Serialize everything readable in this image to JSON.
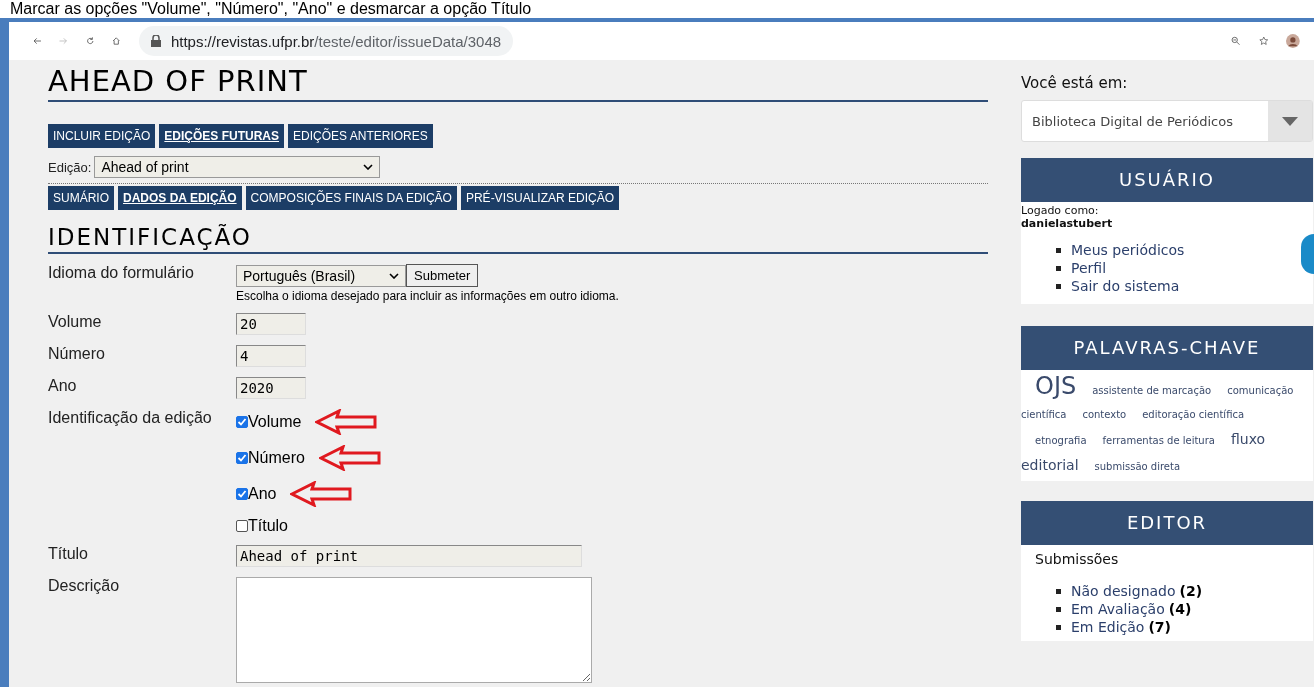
{
  "caption": "Marcar as opções \"Volume\", \"Número\", \"Ano\" e desmarcar a opção Título",
  "browser": {
    "url_host": "https://revistas.ufpr.br",
    "url_path": "/teste/editor/issueData/3048"
  },
  "page_title": "AHEAD OF PRINT",
  "issue_tabs": [
    {
      "label": "INCLUIR EDIÇÃO",
      "selected": false
    },
    {
      "label": "EDIÇÕES FUTURAS",
      "selected": true
    },
    {
      "label": "EDIÇÕES ANTERIORES",
      "selected": false
    }
  ],
  "issue_select": {
    "label": "Edição:",
    "value": "Ahead of print"
  },
  "sub_tabs": [
    {
      "label": "SUMÁRIO",
      "selected": false
    },
    {
      "label": "DADOS DA EDIÇÃO",
      "selected": true
    },
    {
      "label": "COMPOSIÇÕES FINAIS DA EDIÇÃO",
      "selected": false
    },
    {
      "label": "PRÉ-VISUALIZAR EDIÇÃO",
      "selected": false
    }
  ],
  "section_title": "IDENTIFICAÇÃO",
  "form": {
    "language": {
      "label": "Idioma do formulário",
      "value": "Português (Brasil)",
      "button": "Submeter",
      "hint": "Escolha o idioma desejado para incluir as informações em outro idioma."
    },
    "fields": [
      {
        "label": "Volume",
        "value": "20"
      },
      {
        "label": "Número",
        "value": "4"
      },
      {
        "label": "Ano",
        "value": "2020"
      }
    ],
    "identification": {
      "label": "Identificação da edição",
      "options": [
        {
          "label": "Volume",
          "checked": true,
          "annotated": true
        },
        {
          "label": "Número",
          "checked": true,
          "annotated": true
        },
        {
          "label": "Ano",
          "checked": true,
          "annotated": true
        },
        {
          "label": "Título",
          "checked": false,
          "annotated": false
        }
      ]
    },
    "title": {
      "label": "Título",
      "value": "Ahead of print"
    },
    "description": {
      "label": "Descrição"
    }
  },
  "sidebar": {
    "location": {
      "label": "Você está em:",
      "value": "Biblioteca Digital de Periódicos"
    },
    "user": {
      "heading": "USUÁRIO",
      "logged_as": "Logado como:",
      "username": "danielastubert",
      "links": [
        "Meus periódicos",
        "Perfil",
        "Sair do sistema"
      ]
    },
    "keywords": {
      "heading": "PALAVRAS-CHAVE",
      "lines": [
        [
          {
            "label": "OJS",
            "kind": "large"
          },
          {
            "label": "assistente de marcação",
            "kind": "small"
          },
          {
            "label": "comunicação",
            "kind": "small"
          }
        ],
        [
          {
            "label": "científica",
            "kind": "small"
          },
          {
            "label": "contexto",
            "kind": "small"
          },
          {
            "label": "editoração científica",
            "kind": "small"
          }
        ],
        [
          {
            "label": "etnografia",
            "kind": "small"
          },
          {
            "label": "ferramentas de leitura",
            "kind": "small"
          },
          {
            "label": "fluxo",
            "kind": "medium"
          }
        ],
        [
          {
            "label": "editorial",
            "kind": "medium"
          },
          {
            "label": "submissão direta",
            "kind": "small"
          }
        ]
      ]
    },
    "editor": {
      "heading": "EDITOR",
      "subheading": "Submissões",
      "items": [
        {
          "label": "Não designado",
          "count": "(2)"
        },
        {
          "label": "Em Avaliação",
          "count": "(4)"
        },
        {
          "label": "Em Edição",
          "count": "(7)"
        }
      ]
    }
  }
}
